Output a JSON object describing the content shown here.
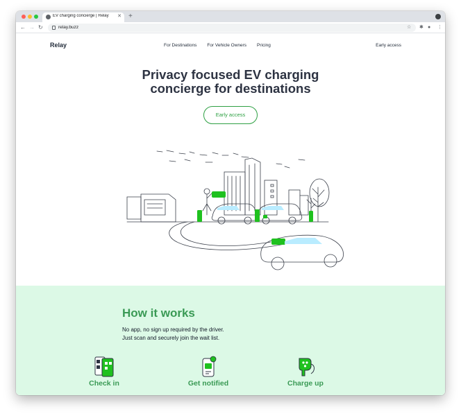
{
  "browser": {
    "tab_title": "EV charging concierge | Relay",
    "url": "relay.buzz",
    "colors": {
      "close": "#ff5f57",
      "minimize": "#febc2e",
      "maximize": "#28c840"
    }
  },
  "nav": {
    "brand": "Relay",
    "links": [
      "For Destinations",
      "For Vehicle Owners",
      "Pricing"
    ],
    "cta": "Early access"
  },
  "hero": {
    "title_line1": "Privacy focused EV charging",
    "title_line2": "concierge for destinations",
    "cta": "Early access"
  },
  "how_it_works": {
    "title": "How it works",
    "subtitle_line1": "No app, no sign up required by the driver.",
    "subtitle_line2": "Just scan and securely join the wait list.",
    "steps": [
      {
        "label": "Check in",
        "icon": "qr-phone-icon"
      },
      {
        "label": "Get notified",
        "icon": "notification-phone-icon"
      },
      {
        "label": "Charge up",
        "icon": "charger-plug-icon"
      }
    ]
  },
  "colors": {
    "accent": "#2ea043",
    "heading": "#2d3342",
    "section_bg": "#dcf9e6",
    "charger_green": "#1fc11f"
  }
}
